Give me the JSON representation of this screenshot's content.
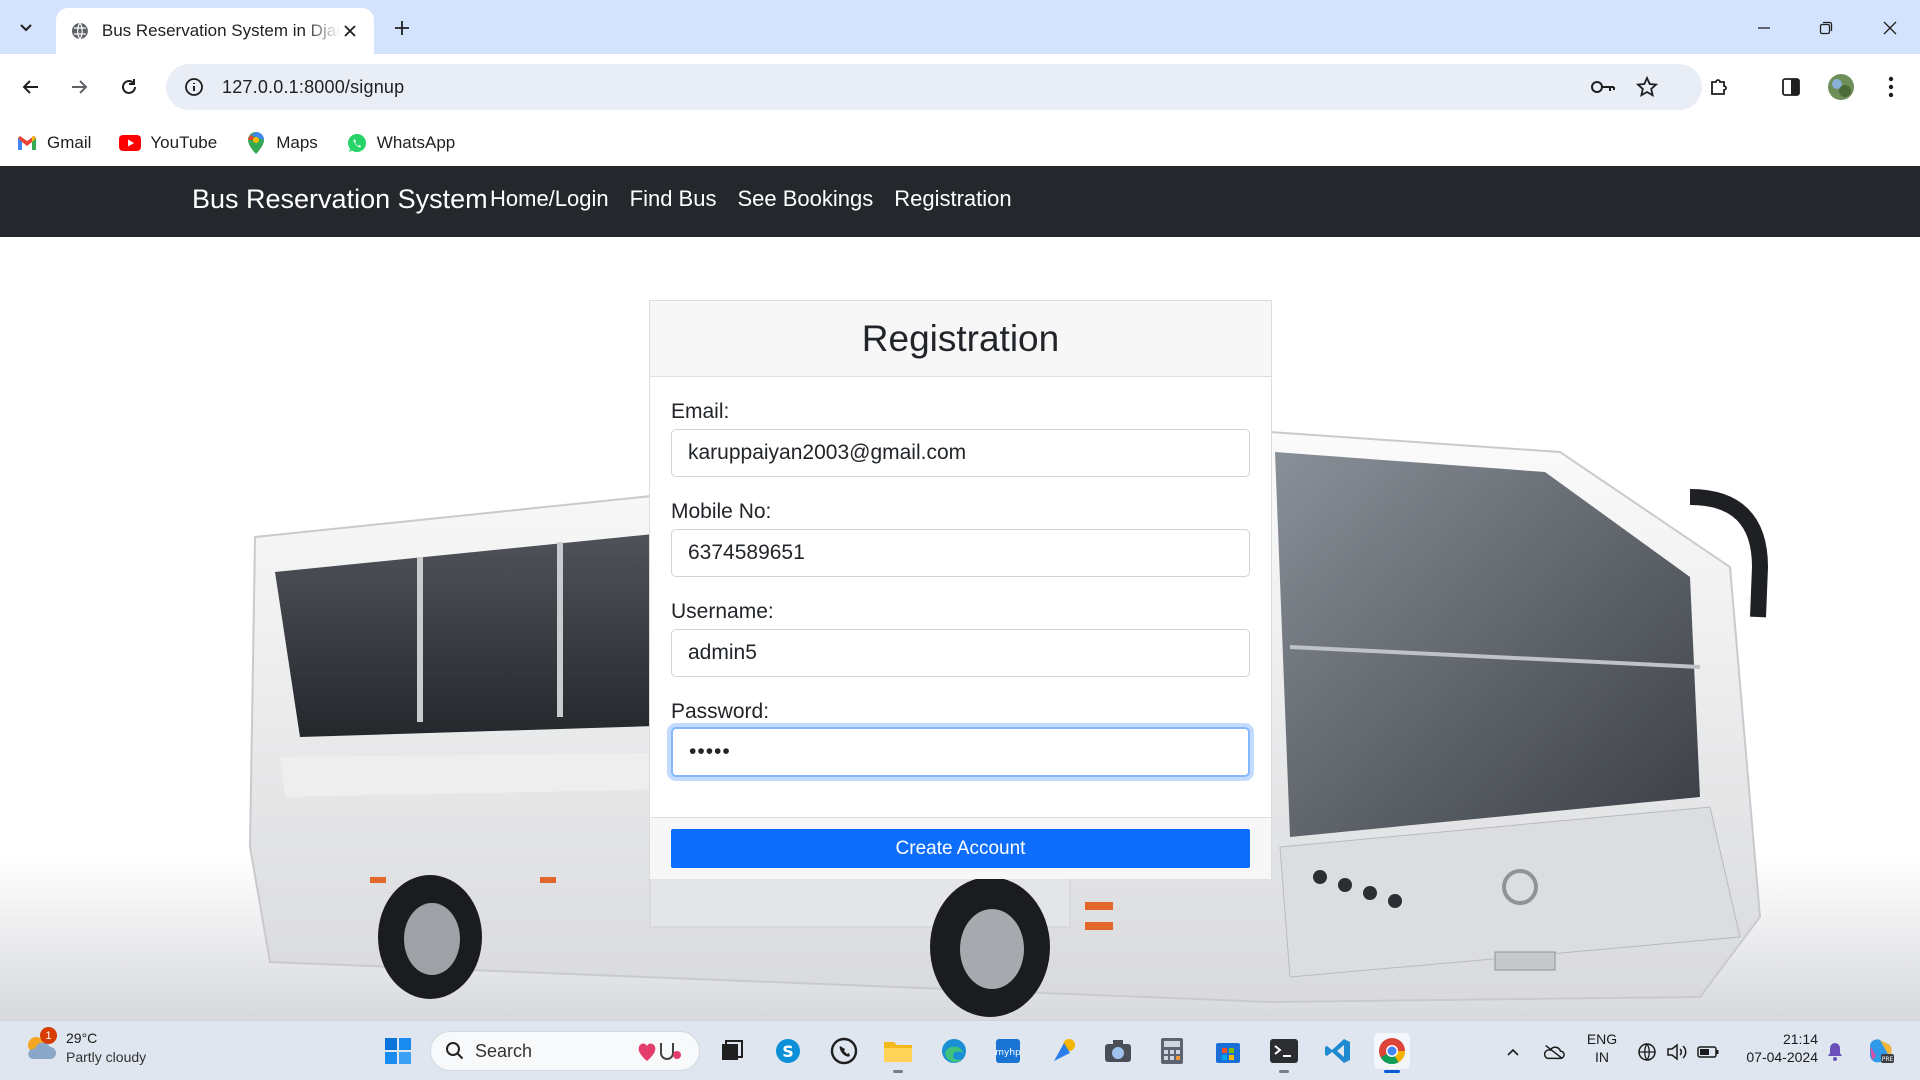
{
  "browser": {
    "tab_title": "Bus Reservation System in Django",
    "url": "127.0.0.1:8000/signup",
    "bookmarks": [
      {
        "label": "Gmail",
        "icon": "gmail-icon"
      },
      {
        "label": "YouTube",
        "icon": "youtube-icon"
      },
      {
        "label": "Maps",
        "icon": "maps-icon"
      },
      {
        "label": "WhatsApp",
        "icon": "whatsapp-icon"
      }
    ]
  },
  "site": {
    "brand": "Bus Reservation System",
    "nav": [
      "Home/Login",
      "Find Bus",
      "See Bookings",
      "Registration"
    ]
  },
  "form": {
    "title": "Registration",
    "email_label": "Email:",
    "email_value": "karuppaiyan2003@gmail.com",
    "mobile_label": "Mobile No:",
    "mobile_value": "6374589651",
    "username_label": "Username:",
    "username_value": "admin5",
    "password_label": "Password:",
    "password_value": "•••••",
    "submit_label": "Create Account"
  },
  "taskbar": {
    "weather_temp": "29°C",
    "weather_desc": "Partly cloudy",
    "weather_badge": "1",
    "search_label": "Search",
    "lang_top": "ENG",
    "lang_bottom": "IN",
    "time": "21:14",
    "date": "07-04-2024"
  },
  "colors": {
    "navbar": "#24272b",
    "primary_button": "#0d6efd",
    "tab_strip": "#d3e3fd"
  }
}
